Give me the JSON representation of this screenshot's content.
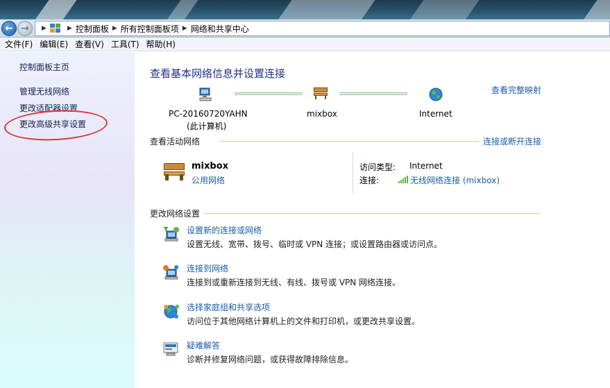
{
  "nav": {
    "breadcrumbs": [
      "控制面板",
      "所有控制面板项",
      "网络和共享中心"
    ]
  },
  "menu": [
    "文件(F)",
    "编辑(E)",
    "查看(V)",
    "工具(T)",
    "帮助(H)"
  ],
  "sidebar": {
    "items": [
      {
        "label": "控制面板主页"
      },
      {
        "label": "管理无线网络"
      },
      {
        "label": "更改适配器设置"
      },
      {
        "label": "更改高级共享设置"
      }
    ],
    "annotation_color": "#e0323a"
  },
  "main": {
    "title": "查看基本网络信息并设置连接",
    "view_full_map": "查看完整映射",
    "map": {
      "computer": "PC-20160720YAHN",
      "computer_sub": "(此计算机)",
      "network": "mixbox",
      "internet": "Internet"
    },
    "active": {
      "heading": "查看活动网络",
      "link": "连接或断开连接",
      "network_name": "mixbox",
      "network_type": "公用网络",
      "access_type_label": "访问类型:",
      "access_type_value": "Internet",
      "connection_label": "连接:",
      "connection_value": "无线网络连接 (mixbox)"
    },
    "change": {
      "heading": "更改网络设置",
      "tasks": [
        {
          "title": "设置新的连接或网络",
          "desc": "设置无线、宽带、拨号、临时或 VPN 连接；或设置路由器或访问点。",
          "icon": "new-connection-icon"
        },
        {
          "title": "连接到网络",
          "desc": "连接到或重新连接到无线、有线、拨号或 VPN 网络连接。",
          "icon": "connect-network-icon"
        },
        {
          "title": "选择家庭组和共享选项",
          "desc": "访问位于其他网络计算机上的文件和打印机，或更改共享设置。",
          "icon": "homegroup-icon"
        },
        {
          "title": "疑难解答",
          "desc": "诊断并修复网络问题，或获得故障排除信息。",
          "icon": "troubleshoot-icon"
        }
      ]
    }
  },
  "colors": {
    "link": "#1c5ca8",
    "title": "#1e3287",
    "section_rule": "#c3d19c"
  }
}
